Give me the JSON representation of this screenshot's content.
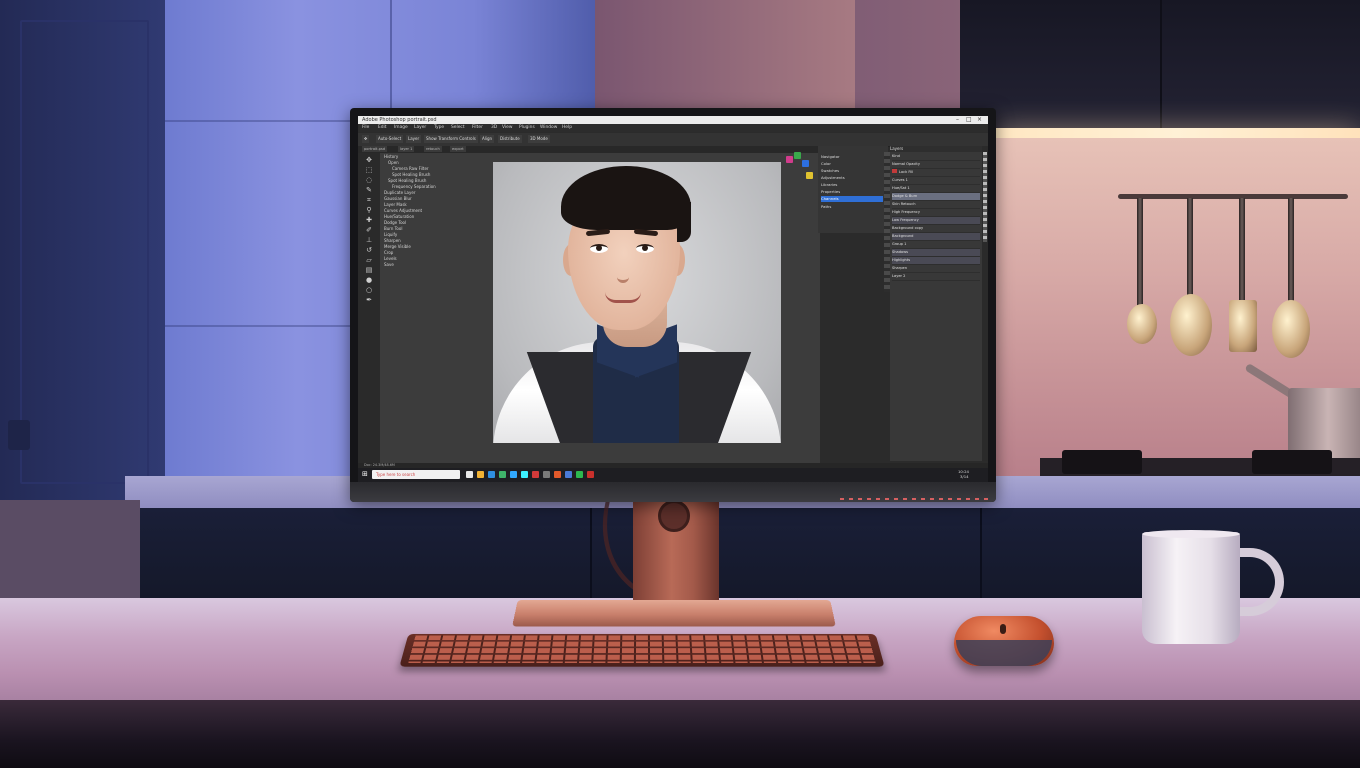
{
  "app": {
    "title_bar": "Adobe Photoshop  portrait.psd",
    "window_controls": [
      "–",
      "□",
      "×"
    ],
    "menu": [
      "File",
      "Edit",
      "Image",
      "Layer",
      "Type",
      "Select",
      "Filter",
      "3D",
      "View",
      "Plugins",
      "Window",
      "Help"
    ],
    "options_bar": [
      "Auto-Select",
      "Layer",
      "Show Transform Controls",
      "Align",
      "Distribute",
      "3D Mode"
    ],
    "document_tabs": [
      "portrait.psd",
      "layer 1",
      "retouch",
      "export"
    ],
    "tools": [
      "move-icon",
      "marquee-icon",
      "lasso-icon",
      "quick-select-icon",
      "crop-icon",
      "eyedropper-icon",
      "healing-icon",
      "brush-icon",
      "stamp-icon",
      "history-brush-icon",
      "eraser-icon",
      "gradient-icon",
      "blur-icon",
      "dodge-icon",
      "pen-icon",
      "type-icon",
      "path-select-icon",
      "shape-icon",
      "hand-icon",
      "zoom-icon"
    ],
    "history_panel": [
      "History",
      "Open",
      "Camera Raw Filter",
      "Spot Healing Brush",
      "Spot Healing Brush",
      "Frequency Separation",
      "Duplicate Layer",
      "Gaussian Blur",
      "Layer Mask",
      "Curves Adjustment",
      "Hue/Saturation",
      "Dodge Tool",
      "Burn Tool",
      "Liquify",
      "Sharpen",
      "Merge Visible",
      "Crop",
      "Levels",
      "Save"
    ],
    "navigator_panel": [
      "Navigator",
      "Color",
      "Swatches",
      "Adjustments",
      "Libraries",
      "Properties",
      "Channels",
      "Paths"
    ],
    "navigator_selected_index": 6,
    "layers_panel": {
      "title": "Layers",
      "rows": [
        "Kind",
        "Normal  Opacity",
        "Lock  Fill",
        "Curves 1",
        "Hue/Sat 1",
        "Dodge & Burn",
        "Skin Retouch",
        "High Frequency",
        "Low Frequency",
        "Background copy",
        "Background",
        "Group 1",
        "Shadows",
        "Highlights",
        "Sharpen",
        "Layer 2"
      ],
      "highlighted_index": 5
    },
    "status": "Doc: 24.3M/48.6M",
    "taskbar": {
      "search_placeholder": "Type here to search",
      "icons": [
        "task-view-icon",
        "folder-icon",
        "edge-icon",
        "chrome-icon",
        "photoshop-icon",
        "lightroom-icon",
        "mail-icon",
        "store-icon",
        "media-icon",
        "settings-icon",
        "spotify-icon",
        "camera-icon"
      ],
      "clock": "10:24",
      "date": "3/14"
    }
  },
  "colors": {
    "app_bg": "#2b2b2b",
    "selection": "#2f6fd6",
    "monitor_stand": "#b86a57",
    "wall_left": "#4b5aa4",
    "backsplash": "#d7a9a6"
  }
}
